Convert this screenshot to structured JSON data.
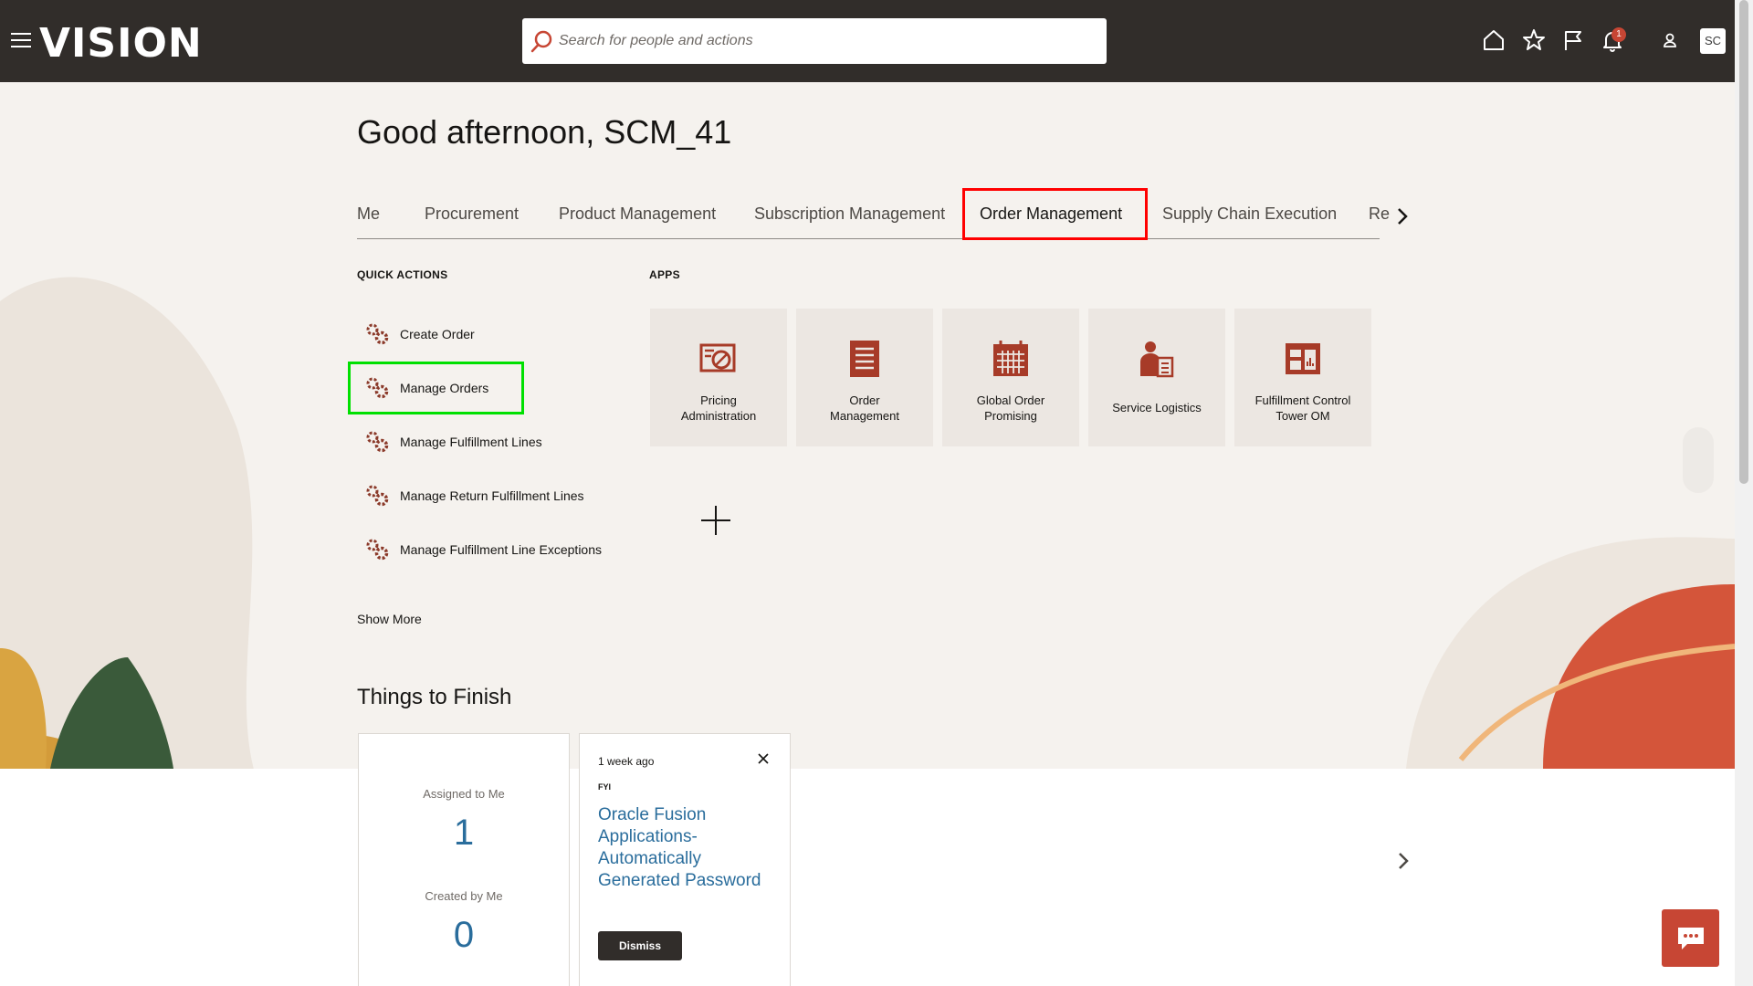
{
  "header": {
    "logo": "VISION",
    "search_placeholder": "Search for people and actions",
    "notification_count": "1",
    "user_initials": "SC"
  },
  "greeting": "Good afternoon, SCM_41",
  "tabs": [
    {
      "label": "Me"
    },
    {
      "label": "Procurement"
    },
    {
      "label": "Product Management"
    },
    {
      "label": "Subscription Management"
    },
    {
      "label": "Order Management",
      "selected": true
    },
    {
      "label": "Supply Chain Execution"
    },
    {
      "label": "Re"
    }
  ],
  "quick_actions": {
    "heading": "QUICK ACTIONS",
    "items": [
      {
        "label": "Create Order",
        "icon": "gears-icon"
      },
      {
        "label": "Manage Orders",
        "icon": "gears-icon"
      },
      {
        "label": "Manage Fulfillment Lines",
        "icon": "gears-icon"
      },
      {
        "label": "Manage Return Fulfillment Lines",
        "icon": "gears-icon"
      },
      {
        "label": "Manage Fulfillment Line Exceptions",
        "icon": "gears-icon"
      }
    ],
    "show_more": "Show More"
  },
  "apps": {
    "heading": "APPS",
    "items": [
      {
        "line1": "Pricing",
        "line2": "Administration",
        "icon": "pricing-icon"
      },
      {
        "line1": "Order",
        "line2": "Management",
        "icon": "document-list-icon"
      },
      {
        "line1": "Global Order",
        "line2": "Promising",
        "icon": "calendar-icon"
      },
      {
        "line1": "Service Logistics",
        "line2": "",
        "icon": "person-document-icon"
      },
      {
        "line1": "Fulfillment Control",
        "line2": "Tower OM",
        "icon": "dashboard-icon"
      }
    ]
  },
  "things_to_finish": {
    "heading": "Things to Finish",
    "assigned_label": "Assigned to Me",
    "assigned_count": "1",
    "created_label": "Created by Me",
    "created_count": "0",
    "notification": {
      "time": "1 week ago",
      "tag": "FYI",
      "title": "Oracle Fusion Applications-Automatically Generated Password",
      "dismiss": "Dismiss"
    }
  },
  "colors": {
    "header_bg": "#312d2a",
    "accent": "#c74634",
    "link": "#2a6d9c",
    "highlight_red": "#ff0000",
    "highlight_green": "#00e000"
  }
}
